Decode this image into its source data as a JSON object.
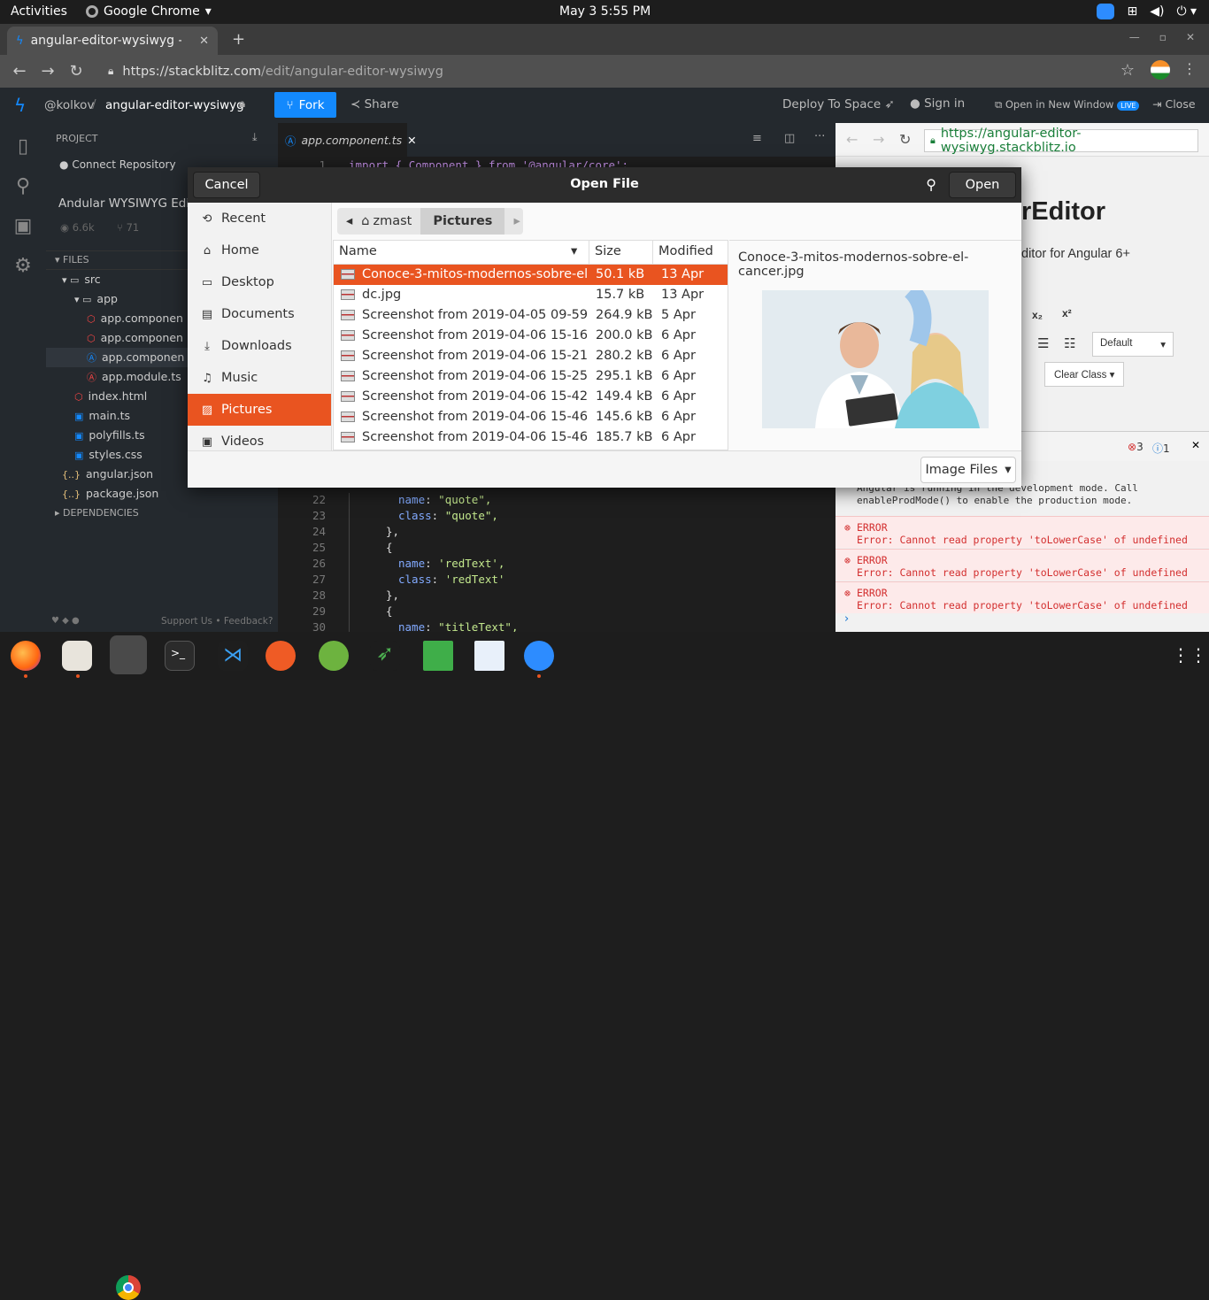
{
  "topbar": {
    "activities": "Activities",
    "app_name": "Google Chrome",
    "clock": "May 3   5:55 PM"
  },
  "browser": {
    "tab_title": "angular-editor-wysiwyg - S",
    "url_host": "https://stackblitz.com",
    "url_path": "/edit/angular-editor-wysiwyg"
  },
  "stackblitz": {
    "user": "@kolkov",
    "separator": "/",
    "project": "angular-editor-wysiwyg",
    "fork_label": "Fork",
    "share_label": "Share",
    "deploy_label": "Deploy To Space",
    "signin_label": "Sign in",
    "open_new_window_label": "Open in New Window",
    "live_badge": "LIVE",
    "close_label": "Close"
  },
  "sidebar": {
    "project_header": "PROJECT",
    "connect_repo": "Connect Repository",
    "project_title": "Andular WYSIWYG Edito",
    "views": "6.6k",
    "forks": "71",
    "files_header": "FILES",
    "dependencies_header": "DEPENDENCIES",
    "footer": "Support Us • Feedback?",
    "tree": [
      {
        "label": "src",
        "indent": 0,
        "icon": "▾ ▭",
        "color": "#ccc"
      },
      {
        "label": "app",
        "indent": 1,
        "icon": "▾ ▭",
        "color": "#ccc"
      },
      {
        "label": "app.componen",
        "indent": 2,
        "icon": "⬡",
        "color": "#e44"
      },
      {
        "label": "app.componen",
        "indent": 2,
        "icon": "⬡",
        "color": "#e44"
      },
      {
        "label": "app.componen",
        "indent": 2,
        "icon": "Ⓐ",
        "color": "#1389fd",
        "active": true
      },
      {
        "label": "app.module.ts",
        "indent": 2,
        "icon": "Ⓐ",
        "color": "#e44"
      },
      {
        "label": "index.html",
        "indent": 1,
        "icon": "⬡",
        "color": "#e44"
      },
      {
        "label": "main.ts",
        "indent": 1,
        "icon": "▣",
        "color": "#1389fd"
      },
      {
        "label": "polyfills.ts",
        "indent": 1,
        "icon": "▣",
        "color": "#1389fd"
      },
      {
        "label": "styles.css",
        "indent": 1,
        "icon": "▣",
        "color": "#1389fd"
      },
      {
        "label": "angular.json",
        "indent": 0,
        "icon": "{..}",
        "color": "#e5c07b"
      },
      {
        "label": "package.json",
        "indent": 0,
        "icon": "{..}",
        "color": "#e5c07b"
      }
    ]
  },
  "editor": {
    "tab": "app.component.ts",
    "first_line": {
      "num": "1",
      "text": "import { Component } from '@angular/core';"
    },
    "lines": [
      {
        "num": "22",
        "key": "name",
        "val": "\"quote\","
      },
      {
        "num": "23",
        "key": "class",
        "val": "\"quote\","
      },
      {
        "num": "24",
        "key": "",
        "val": "},"
      },
      {
        "num": "25",
        "key": "",
        "val": "{"
      },
      {
        "num": "26",
        "key": "name",
        "val": "'redText',"
      },
      {
        "num": "27",
        "key": "class",
        "val": "'redText'"
      },
      {
        "num": "28",
        "key": "",
        "val": "},"
      },
      {
        "num": "29",
        "key": "",
        "val": "{"
      },
      {
        "num": "30",
        "key": "name",
        "val": "\"titleText\","
      }
    ]
  },
  "preview": {
    "url": "https://angular-editor-wysiwyg.stackblitz.io",
    "heading": "rEditor",
    "subheading": "ditor for Angular 6+",
    "subscript": "x₂",
    "superscript": "x²",
    "font_select": "Default",
    "class_select": "Clear Class",
    "error_count": "3",
    "info_count": "1",
    "console_info": "Angular is running in the development mode. Call\nenableProdMode() to enable the production mode.",
    "errors": [
      {
        "title": "ERROR",
        "msg": "Error: Cannot read property 'toLowerCase' of undefined"
      },
      {
        "title": "ERROR",
        "msg": "Error: Cannot read property 'toLowerCase' of undefined"
      },
      {
        "title": "ERROR",
        "msg": "Error: Cannot read property 'toLowerCase' of undefined"
      }
    ]
  },
  "dialog": {
    "title": "Open File",
    "cancel": "Cancel",
    "open": "Open",
    "crumb_home": "zmast",
    "crumb_current": "Pictures",
    "places": [
      {
        "label": "Recent",
        "icon": "⟲"
      },
      {
        "label": "Home",
        "icon": "⌂"
      },
      {
        "label": "Desktop",
        "icon": "▭"
      },
      {
        "label": "Documents",
        "icon": "▤"
      },
      {
        "label": "Downloads",
        "icon": "⤓"
      },
      {
        "label": "Music",
        "icon": "♫"
      },
      {
        "label": "Pictures",
        "icon": "▨",
        "selected": true
      },
      {
        "label": "Videos",
        "icon": "▣"
      }
    ],
    "columns": {
      "name": "Name",
      "size": "Size",
      "modified": "Modified"
    },
    "files": [
      {
        "name": "Conoce-3-mitos-modernos-sobre-el...",
        "size": "50.1 kB",
        "modified": "13 Apr",
        "selected": true
      },
      {
        "name": "dc.jpg",
        "size": "15.7 kB",
        "modified": "13 Apr"
      },
      {
        "name": "Screenshot from 2019-04-05 09-59-5...",
        "size": "264.9 kB",
        "modified": "5 Apr"
      },
      {
        "name": "Screenshot from 2019-04-06 15-16-1...",
        "size": "200.0 kB",
        "modified": "6 Apr"
      },
      {
        "name": "Screenshot from 2019-04-06 15-21-0...",
        "size": "280.2 kB",
        "modified": "6 Apr"
      },
      {
        "name": "Screenshot from 2019-04-06 15-25-4...",
        "size": "295.1 kB",
        "modified": "6 Apr"
      },
      {
        "name": "Screenshot from 2019-04-06 15-42-2...",
        "size": "149.4 kB",
        "modified": "6 Apr"
      },
      {
        "name": "Screenshot from 2019-04-06 15-46-3...",
        "size": "145.6 kB",
        "modified": "6 Apr"
      },
      {
        "name": "Screenshot from 2019-04-06 15-46-5...",
        "size": "185.7 kB",
        "modified": "6 Apr"
      }
    ],
    "preview_name": "Conoce-3-mitos-modernos-sobre-el-cancer.jpg",
    "filter": "Image Files"
  },
  "taskbar": [
    "firefox-icon",
    "files-icon",
    "chrome-icon",
    "terminal-icon",
    "vscode-icon",
    "postman-icon",
    "spring-icon",
    "rocket-icon",
    "calc-icon",
    "editor-icon",
    "zoom-icon"
  ],
  "colors": {
    "accent": "#e95420",
    "stackblitz_blue": "#1389fd",
    "error": "#d32f2f"
  }
}
